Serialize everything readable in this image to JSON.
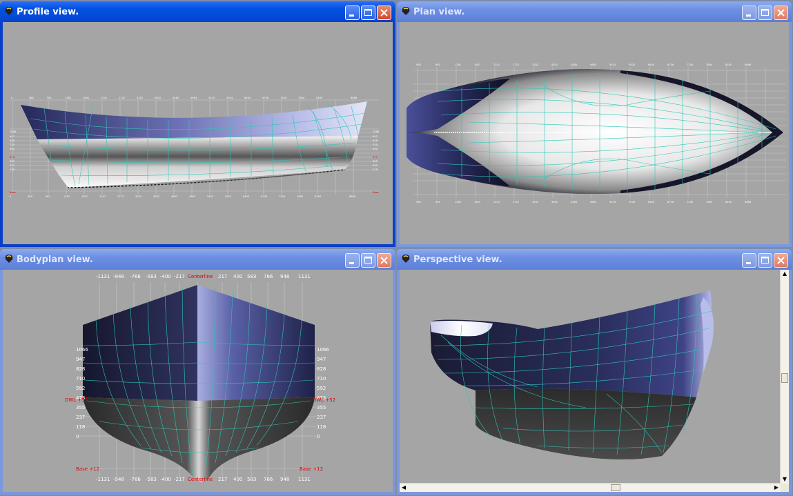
{
  "windows": {
    "profile": {
      "title": "Profile view."
    },
    "plan": {
      "title": "Plan view."
    },
    "bodyplan": {
      "title": "Bodyplan view."
    },
    "perspective": {
      "title": "Perspective view."
    }
  },
  "profile_view": {
    "station_ticks": [
      "0",
      "480",
      "961",
      "1281",
      "1601",
      "2241",
      "2722",
      "3202",
      "4002",
      "4483",
      "4963",
      "5443",
      "5924",
      "6404",
      "6756",
      "7204",
      "7684",
      "8165",
      "8686"
    ],
    "waterline_ticks": [
      "1066",
      "947",
      "828",
      "710",
      "592",
      "473",
      "355",
      "237",
      "118"
    ],
    "waterline_red": "473",
    "base_red": "Base"
  },
  "plan_view": {
    "station_ticks": [
      "480",
      "961",
      "1281",
      "1601",
      "2241",
      "2722",
      "3202",
      "4002",
      "4483",
      "4963",
      "5443",
      "5924",
      "6404",
      "6756",
      "7204",
      "7684",
      "8165",
      "8686"
    ]
  },
  "bodyplan_view": {
    "top_ticks": [
      "-1131",
      "-948",
      "-766",
      "-583",
      "-400",
      "-217",
      "Centerline",
      "217",
      "400",
      "583",
      "766",
      "948",
      "1131"
    ],
    "bottom_ticks": [
      "-1131",
      "-948",
      "-766",
      "-583",
      "-400",
      "-217",
      "Centerline",
      "217",
      "400",
      "583",
      "766",
      "948",
      "1131"
    ],
    "left_ticks": [
      "1066",
      "947",
      "828",
      "710",
      "592",
      "473",
      "355",
      "237",
      "118",
      "0"
    ],
    "right_ticks": [
      "1066",
      "947",
      "828",
      "710",
      "592",
      "473",
      "355",
      "237",
      "118",
      "0"
    ],
    "dwl_left": "DWL +52",
    "dwl_right": "DWL +52",
    "base_left": "Base +12",
    "base_right": "Base +12"
  },
  "colors": {
    "hull_topside": "#1e2147",
    "hull_highlight": "#c9cdf2",
    "grid_line": "#2dc7b7",
    "canvas_bg": "#a5a5a5",
    "title_active": "#0449d6",
    "title_inactive": "#7b98de"
  }
}
